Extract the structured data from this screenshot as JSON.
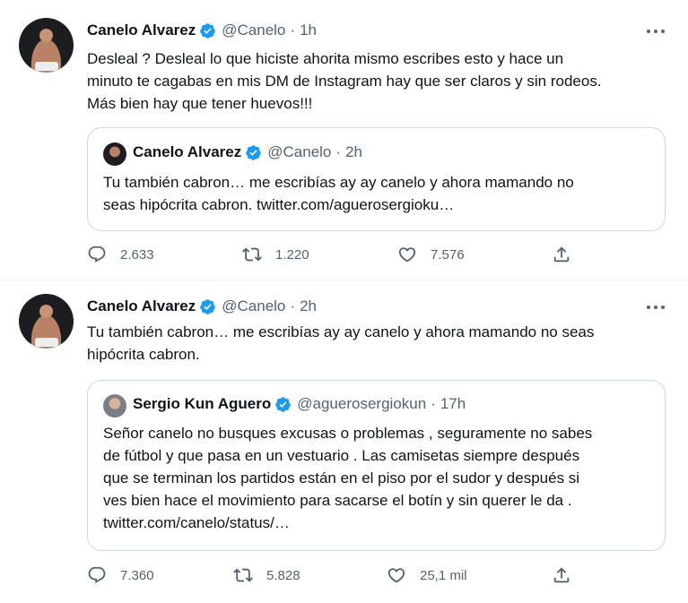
{
  "colors": {
    "verified": "#1d9bf0",
    "text": "#0f1419",
    "secondary": "#536471",
    "border": "#cfd9de"
  },
  "tweets": [
    {
      "author": "Canelo Alvarez",
      "handle": "@Canelo",
      "dot": "·",
      "time": "1h",
      "text": "Desleal ? Desleal lo que hiciste ahorita mismo escribes esto y hace un\nminuto te cagabas en mis DM de Instagram hay que ser claros y sin rodeos.\nMás bien hay que tener huevos!!!",
      "quote": {
        "author": "Canelo Alvarez",
        "handle": "@Canelo",
        "dot": "·",
        "time": "2h",
        "text": "Tu también cabron… me escribías ay ay canelo y ahora mamando no\nseas hipócrita cabron. twitter.com/aguerosergioku…"
      },
      "stats": {
        "replies": "2.633",
        "retweets": "1.220",
        "likes": "7.576"
      }
    },
    {
      "author": "Canelo Alvarez",
      "handle": "@Canelo",
      "dot": "·",
      "time": "2h",
      "text": "Tu también cabron… me escribías ay ay canelo y ahora mamando no seas\nhipócrita cabron.",
      "quote": {
        "author": "Sergio Kun Aguero",
        "handle": "@aguerosergiokun",
        "dot": "·",
        "time": "17h",
        "text": "Señor canelo no busques excusas o problemas , seguramente no sabes\nde fútbol y que pasa en un vestuario . Las camisetas siempre después\nque se terminan los partidos  están en el piso por el sudor y después si\nves bien hace el movimiento para sacarse el botín y sin querer le da .\ntwitter.com/canelo/status/…"
      },
      "stats": {
        "replies": "7.360",
        "retweets": "5.828",
        "likes": "25,1 mil"
      }
    }
  ]
}
